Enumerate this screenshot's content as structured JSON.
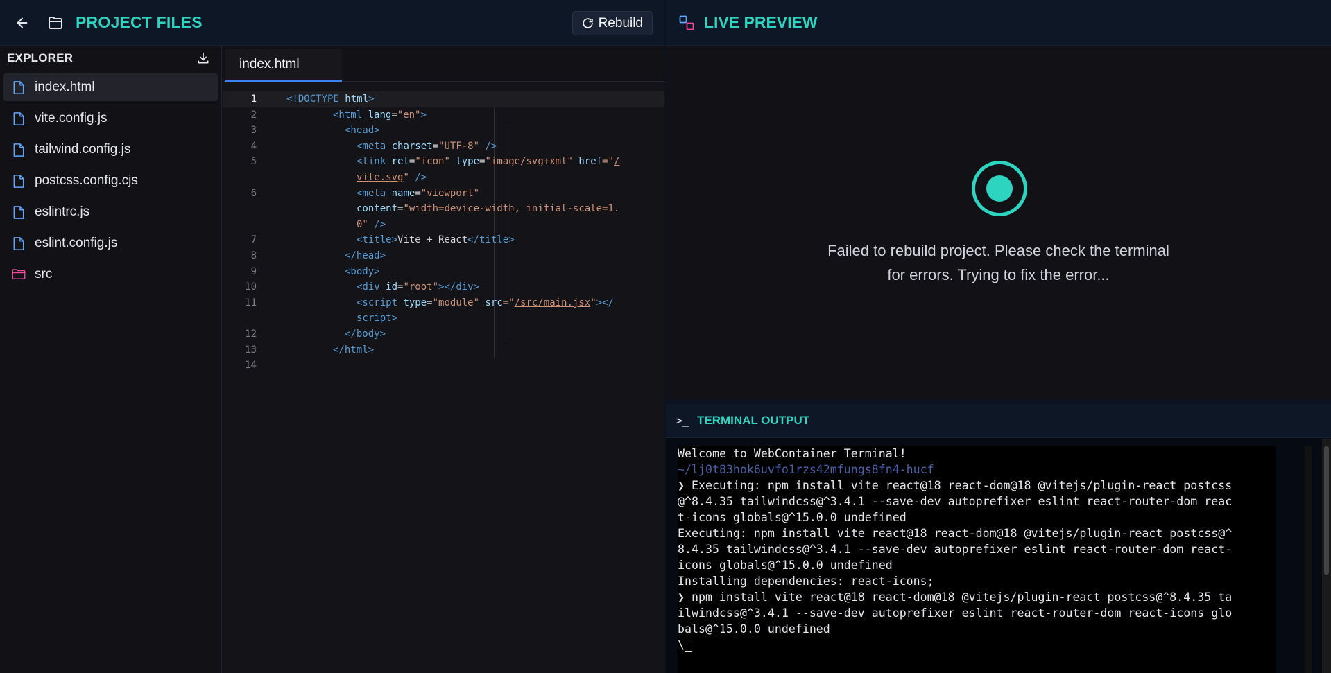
{
  "header": {
    "title": "PROJECT FILES",
    "rebuild_label": "Rebuild"
  },
  "explorer": {
    "title": "EXPLORER",
    "files": [
      {
        "name": "index.html",
        "type": "file",
        "active": true
      },
      {
        "name": "vite.config.js",
        "type": "file"
      },
      {
        "name": "tailwind.config.js",
        "type": "file"
      },
      {
        "name": "postcss.config.cjs",
        "type": "file"
      },
      {
        "name": "eslintrc.js",
        "type": "file"
      },
      {
        "name": "eslint.config.js",
        "type": "file"
      },
      {
        "name": "src",
        "type": "folder"
      }
    ]
  },
  "editor": {
    "tab_label": "index.html",
    "line_numbers": [
      "1",
      "2",
      "3",
      "4",
      "5",
      "6",
      "7",
      "8",
      "9",
      "10",
      "11",
      "12",
      "13",
      "14"
    ],
    "code": {
      "l1_doctype": "<!DOCTYPE",
      "l1_html": " html",
      "l1_end": ">",
      "l2_open": "<html",
      "l2_attr": " lang",
      "l2_eq": "=",
      "l2_val": "\"en\"",
      "l2_end": ">",
      "l3": "<head>",
      "l4_open": "<meta",
      "l4_attr": " charset",
      "l4_val": "\"UTF-8\"",
      "l4_end": " />",
      "l5_open": "<link",
      "l5_a1": " rel",
      "l5_v1": "\"icon\"",
      "l5_a2": " type",
      "l5_v2": "\"image/svg+xml\"",
      "l5_a3": " href",
      "l5_q": "=\"",
      "l5_link1": "/",
      "l5_link2": "vite.svg",
      "l5_q2": "\"",
      "l5_end": " />",
      "l6_open": "<meta",
      "l6_a1": " name",
      "l6_v1": "\"viewport\"",
      "l6_a2": "content",
      "l6_v2a": "\"width=device-width, initial-scale=1.",
      "l6_v2b": "0\"",
      "l6_end": " />",
      "l7_open": "<title>",
      "l7_text": "Vite + React",
      "l7_close": "</title>",
      "l8": "</head>",
      "l9": "<body>",
      "l10_open": "<div",
      "l10_attr": " id",
      "l10_val": "\"root\"",
      "l10_end": "></div>",
      "l11_open": "<script",
      "l11_a1": " type",
      "l11_v1": "\"module\"",
      "l11_a2": " src",
      "l11_q": "=\"",
      "l11_link": "/src/main.jsx",
      "l11_q2": "\"",
      "l11_end": "></",
      "l11b": "script>",
      "l12": "</body>",
      "l13": "</html>"
    }
  },
  "preview": {
    "title": "LIVE PREVIEW",
    "message_line1": "Failed to rebuild project. Please check the terminal",
    "message_line2": "for errors. Trying to fix the error..."
  },
  "terminal": {
    "icon": ">_",
    "title": "TERMINAL OUTPUT",
    "lines": [
      {
        "text": "Welcome to WebContainer Terminal!",
        "style": "normal"
      },
      {
        "text": "~/lj0t83hok6uvfo1rzs42mfungs8fn4-hucf",
        "style": "dim"
      },
      {
        "text": "❯ Executing: npm install vite react@18 react-dom@18 @vitejs/plugin-react postcss",
        "style": "normal"
      },
      {
        "text": "@^8.4.35 tailwindcss@^3.4.1 --save-dev autoprefixer eslint react-router-dom reac",
        "style": "normal"
      },
      {
        "text": "t-icons globals@^15.0.0 undefined",
        "style": "normal"
      },
      {
        "text": "Executing: npm install vite react@18 react-dom@18 @vitejs/plugin-react postcss@^",
        "style": "normal"
      },
      {
        "text": "8.4.35 tailwindcss@^3.4.1 --save-dev autoprefixer eslint react-router-dom react-",
        "style": "normal"
      },
      {
        "text": "icons globals@^15.0.0 undefined",
        "style": "normal"
      },
      {
        "text": "Installing dependencies: react-icons;",
        "style": "normal"
      },
      {
        "text": "❯ npm install vite react@18 react-dom@18 @vitejs/plugin-react postcss@^8.4.35 ta",
        "style": "normal"
      },
      {
        "text": "ilwindcss@^3.4.1 --save-dev autoprefixer eslint react-router-dom react-icons glo",
        "style": "normal"
      },
      {
        "text": "bals@^15.0.0 undefined",
        "style": "normal"
      }
    ],
    "prompt": "\\"
  },
  "colors": {
    "accent": "#2dd4bf",
    "tab_underline": "#3b82f6",
    "file_icon": "#60a5fa",
    "folder_icon": "#ec4899"
  }
}
